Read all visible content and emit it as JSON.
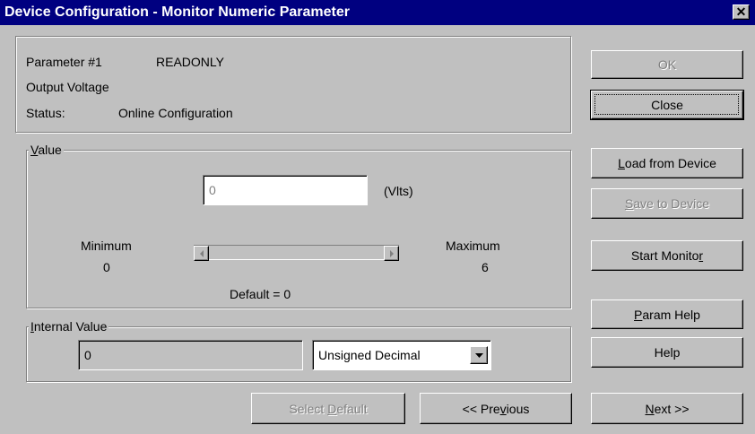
{
  "window": {
    "title": "Device Configuration - Monitor Numeric Parameter",
    "close_glyph": "✕"
  },
  "info": {
    "param_number": "Parameter #1",
    "access": "READONLY",
    "name": "Output Voltage",
    "status_label": "Status:",
    "status_value": "Online Configuration"
  },
  "value_group": {
    "legend_accel": "V",
    "legend_rest": "alue",
    "value": "0",
    "unit": "(Vlts)",
    "minimum_label": "Minimum",
    "minimum_value": "0",
    "maximum_label": "Maximum",
    "maximum_value": "6",
    "default_text": "Default = 0",
    "slider_position": 0
  },
  "internal_group": {
    "legend_accel": "I",
    "legend_rest": "nternal Value",
    "value": "0",
    "format_selected": "Unsigned Decimal"
  },
  "buttons": {
    "ok": "OK",
    "close": "Close",
    "load_accel": "L",
    "load_rest": "oad from Device",
    "save_accel": "S",
    "save_rest": "ave to Device",
    "start_monitor_pre": "Start Monito",
    "start_monitor_accel": "r",
    "param_help_accel": "P",
    "param_help_rest": "aram Help",
    "help": "Help",
    "select_default_pre": "Select ",
    "select_default_accel": "D",
    "select_default_rest": "efault",
    "previous_pre": "<< Pre",
    "previous_accel": "v",
    "previous_rest": "ious",
    "next_accel": "N",
    "next_rest": "ext >>"
  }
}
